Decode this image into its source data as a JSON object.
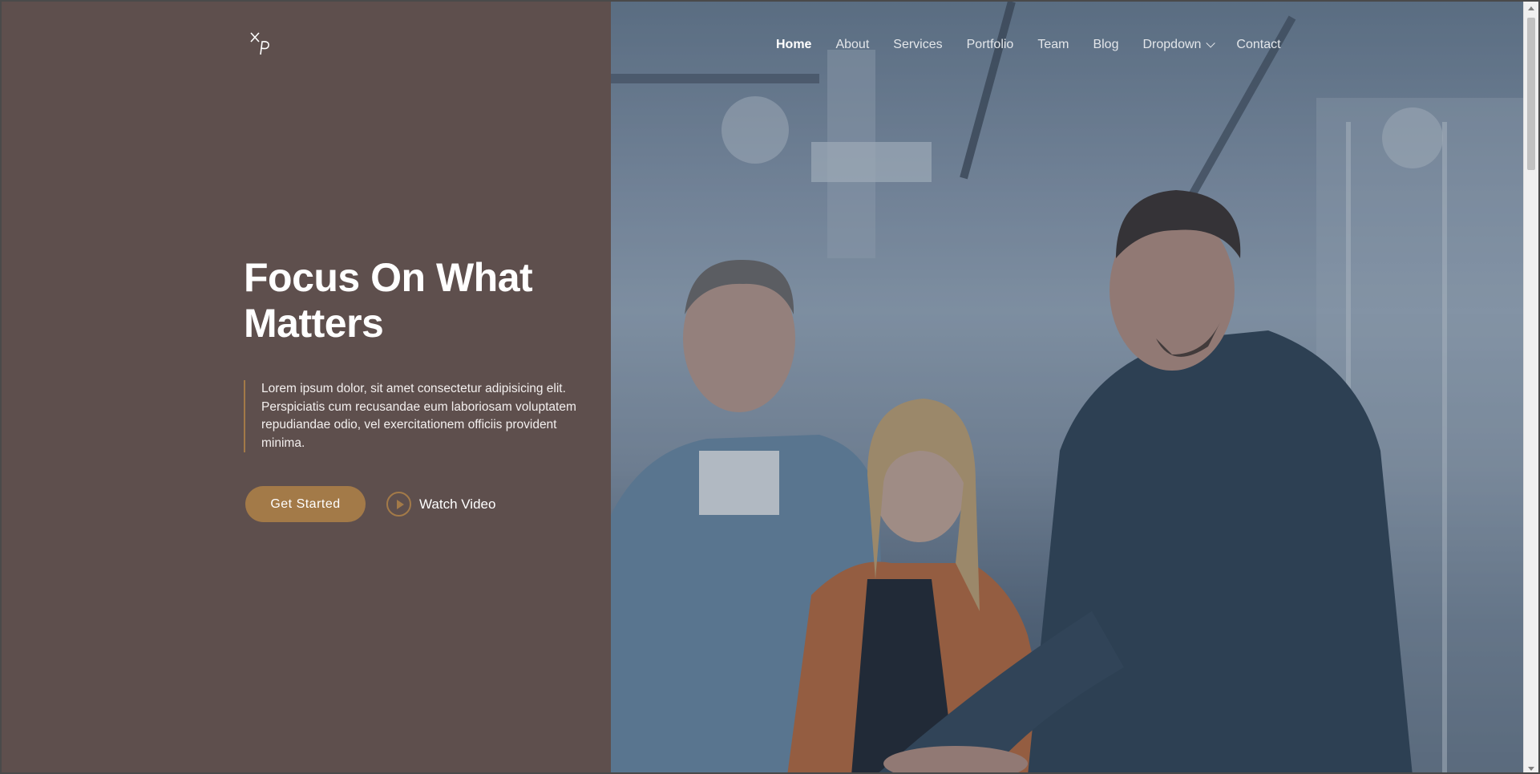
{
  "brand": {
    "logo_text": "XP"
  },
  "nav": {
    "items": [
      {
        "label": "Home",
        "active": true
      },
      {
        "label": "About",
        "active": false
      },
      {
        "label": "Services",
        "active": false
      },
      {
        "label": "Portfolio",
        "active": false
      },
      {
        "label": "Team",
        "active": false
      },
      {
        "label": "Blog",
        "active": false
      },
      {
        "label": "Dropdown",
        "active": false,
        "has_submenu": true
      },
      {
        "label": "Contact",
        "active": false
      }
    ]
  },
  "hero": {
    "title": "Focus On What Matters",
    "description": "Lorem ipsum dolor, sit amet consectetur adipisicing elit. Perspiciatis cum recusandae eum laboriosam voluptatem repudiandae odio, vel exercitationem officiis provident minima.",
    "primary_button": "Get Started",
    "video_button": "Watch Video"
  },
  "colors": {
    "left_panel": "#5e4f4d",
    "accent": "#a37a48",
    "text_light": "#ffffff"
  }
}
